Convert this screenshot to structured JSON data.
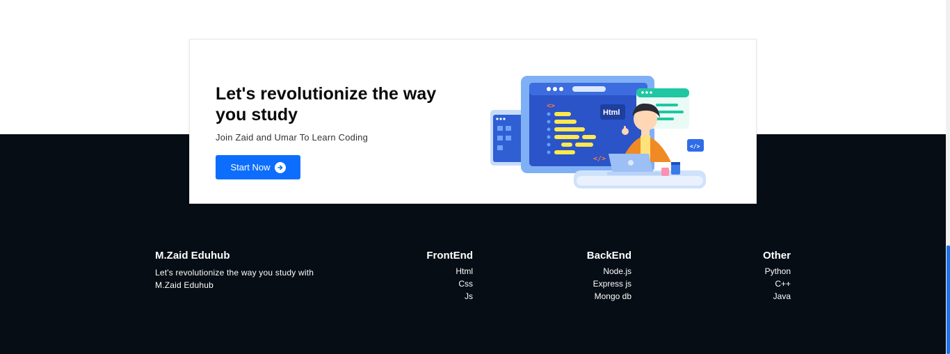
{
  "cta": {
    "title": "Let's revolutionize the way you study",
    "subtitle": "Join Zaid and Umar To Learn Coding",
    "button_label": "Start Now",
    "illustration_tag": "Html"
  },
  "footer": {
    "brand": {
      "name": "M.Zaid Eduhub",
      "tagline": "Let's revolutionize the way you study with M.Zaid Eduhub"
    },
    "columns": [
      {
        "title": "FrontEnd",
        "links": [
          "Html",
          "Css",
          "Js"
        ]
      },
      {
        "title": "BackEnd",
        "links": [
          "Node.js",
          "Express js",
          "Mongo db"
        ]
      },
      {
        "title": "Other",
        "links": [
          "Python",
          "C++",
          "Java"
        ]
      }
    ]
  },
  "colors": {
    "accent": "#0d6efd",
    "footer_bg": "#060d14"
  }
}
